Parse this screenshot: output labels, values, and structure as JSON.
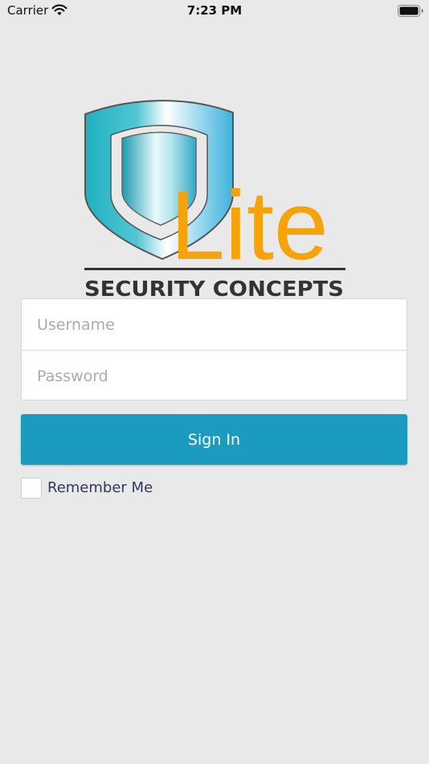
{
  "status_bar": {
    "carrier": "Carrier",
    "time": "7:23 PM",
    "wifi_icon": "wifi-icon",
    "battery_icon": "battery-icon"
  },
  "logo": {
    "word": "Lite",
    "tagline": "SECURITY CONCEPTS",
    "icon": "shield-icon",
    "colors": {
      "shield": "#23b0c3",
      "word": "#f4a30a",
      "tagline": "#333333"
    }
  },
  "login_form": {
    "username_placeholder": "Username",
    "password_placeholder": "Password"
  },
  "sign_in_label": "Sign In",
  "remember_me_label": "Remember Me",
  "colors": {
    "background": "#e9e9e9",
    "accent": "#1c9bc1"
  }
}
